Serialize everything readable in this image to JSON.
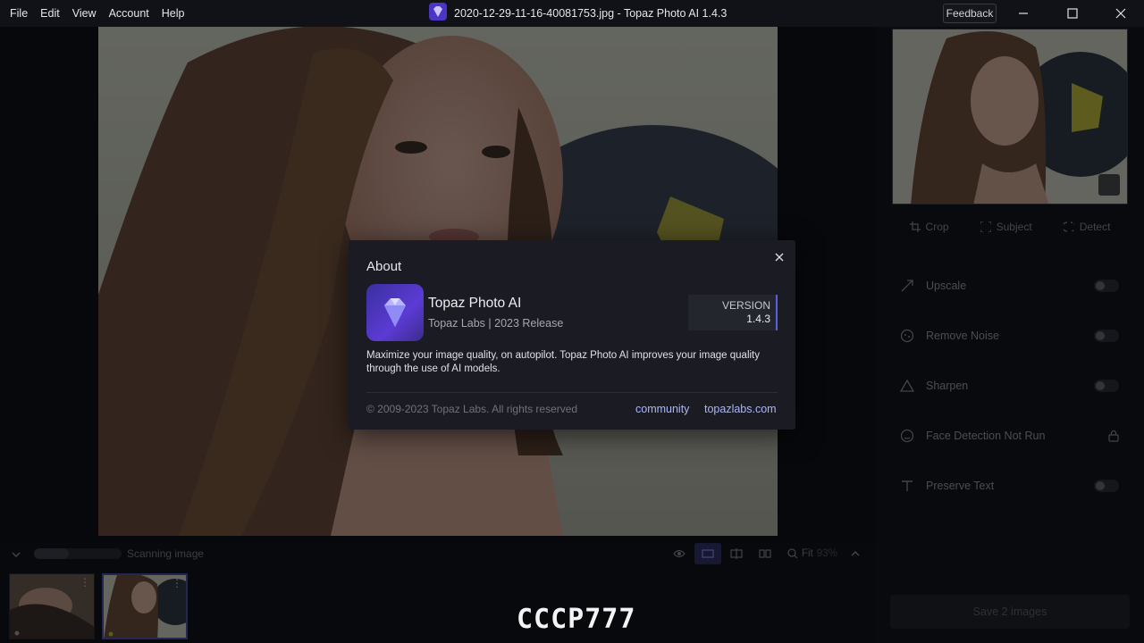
{
  "menu": {
    "items": [
      "File",
      "Edit",
      "View",
      "Account",
      "Help"
    ]
  },
  "window": {
    "title": "2020-12-29-11-16-40081753.jpg - Topaz Photo AI 1.4.3",
    "feedback_label": "Feedback"
  },
  "right_panel": {
    "tools": [
      {
        "label": "Crop",
        "icon": "crop-icon"
      },
      {
        "label": "Subject",
        "icon": "subject-icon"
      },
      {
        "label": "Detect",
        "icon": "detect-icon"
      }
    ],
    "features": [
      {
        "label": "Upscale",
        "icon": "upscale-icon",
        "control": "toggle"
      },
      {
        "label": "Remove Noise",
        "icon": "remove-noise-icon",
        "control": "toggle"
      },
      {
        "label": "Sharpen",
        "icon": "sharpen-icon",
        "control": "toggle"
      },
      {
        "label": "Face Detection Not Run",
        "icon": "face-icon",
        "control": "lock"
      },
      {
        "label": "Preserve Text",
        "icon": "text-icon",
        "control": "toggle"
      }
    ],
    "save_label": "Save 2 images"
  },
  "bottom_bar": {
    "status_text": "Scanning image",
    "progress_fraction": 0.4,
    "zoom_label": "Fit",
    "zoom_value": "93%"
  },
  "watermark": "CCCP777",
  "about": {
    "title": "About",
    "app_name": "Topaz Photo AI",
    "subtitle": "Topaz Labs | 2023 Release",
    "version_label": "VERSION",
    "version_number": "1.4.3",
    "description": "Maximize your image quality, on autopilot. Topaz Photo AI improves your image quality through the use of AI models.",
    "copyright": "© 2009-2023 Topaz Labs. All rights reserved",
    "link_community": "community",
    "link_site": "topazlabs.com"
  },
  "colors": {
    "accent": "#5c5fd6",
    "link": "#a9b6ff",
    "dialog_bg": "#1b1c23"
  }
}
